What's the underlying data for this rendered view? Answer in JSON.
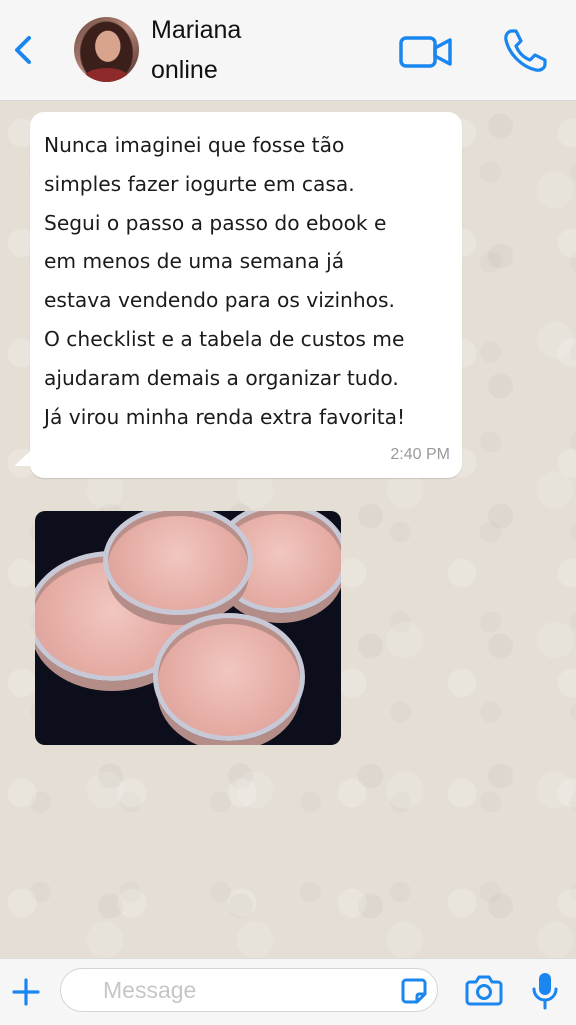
{
  "theme": {
    "accent": "#1a86f0",
    "bubble_bg": "#ffffff",
    "wallpaper": "#e4ded4"
  },
  "header": {
    "back_icon": "chevron-left-icon",
    "contact_name": "Mariana",
    "contact_status": "online",
    "video_icon": "video-camera-icon",
    "call_icon": "phone-icon"
  },
  "messages": [
    {
      "type": "text",
      "direction": "incoming",
      "text": "Nunca imaginei que fosse tão\nsimples fazer iogurte em casa.\nSegui o passo a passo do ebook e\nem menos de uma semana já\nestava vendendo para os vizinhos.\nO checklist e a tabela de custos me\najudaram demais a organizar tudo.\nJá virou minha renda extra favorita!",
      "time": "2:40 PM"
    },
    {
      "type": "image",
      "direction": "incoming",
      "content": "photo of pink yogurt cups"
    }
  ],
  "composer": {
    "plus_icon": "plus-icon",
    "placeholder": "Message",
    "value": "",
    "sticker_icon": "sticker-icon",
    "camera_icon": "camera-icon",
    "mic_icon": "microphone-icon"
  }
}
